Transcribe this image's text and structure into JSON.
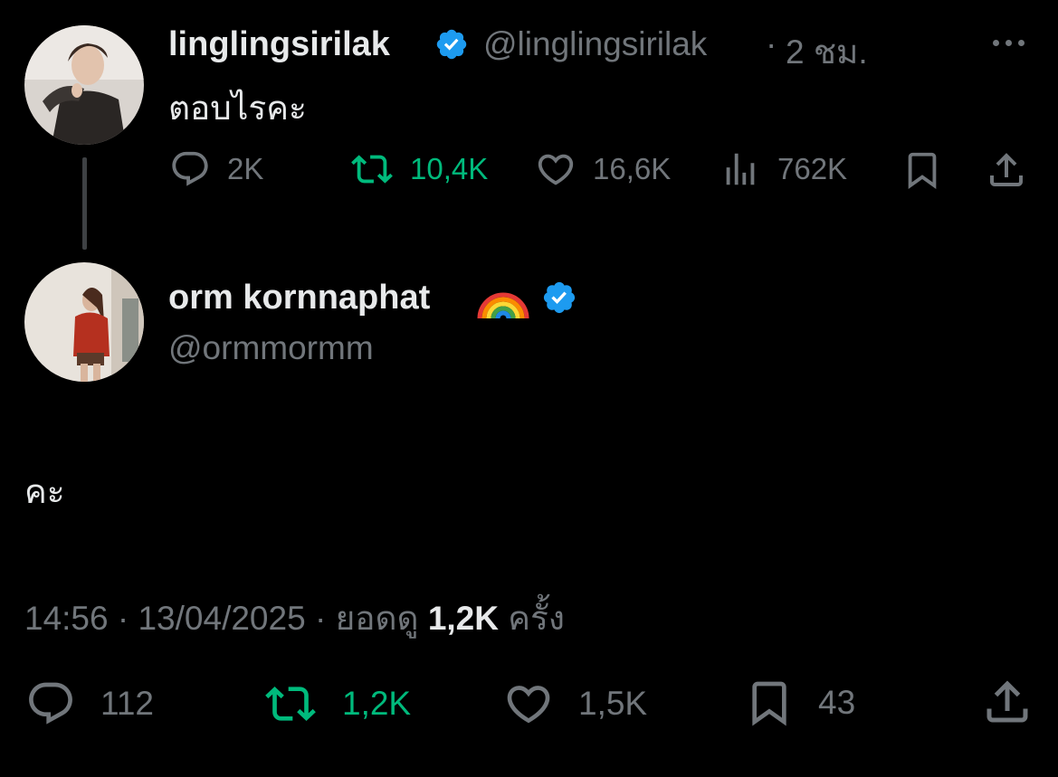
{
  "colors": {
    "background": "#000000",
    "primary_text": "#e7e9ea",
    "secondary_text": "#71767b",
    "retweet_green": "#00ba7c",
    "verified_blue": "#1d9bf0",
    "thread_line": "#3e4144"
  },
  "parent_tweet": {
    "display_name": "linglingsirilak",
    "handle": "@linglingsirilak",
    "separator": "·",
    "time_ago": "2 ชม.",
    "text": "ตอบไรคะ",
    "verified_icon": "verified-badge-icon",
    "more_icon": "more-horizontal-icon",
    "actions": {
      "reply": {
        "icon": "reply-icon",
        "count": "2K"
      },
      "repost": {
        "icon": "repost-icon",
        "count": "10,4K"
      },
      "like": {
        "icon": "heart-icon",
        "count": "16,6K"
      },
      "views": {
        "icon": "views-chart-icon",
        "count": "762K"
      },
      "bookmark": {
        "icon": "bookmark-icon"
      },
      "share": {
        "icon": "share-icon"
      }
    }
  },
  "reply_tweet": {
    "display_name": "orm kornnaphat",
    "name_emoji": "🌈",
    "handle": "@ormmormm",
    "verified_icon": "verified-badge-icon",
    "text": "คะ",
    "meta": {
      "time": "14:56",
      "date": "13/04/2025",
      "views_prefix": "ยอดดู",
      "views_count": "1,2K",
      "views_suffix": "ครั้ง"
    },
    "actions": {
      "reply": {
        "icon": "reply-icon",
        "count": "112"
      },
      "repost": {
        "icon": "repost-icon",
        "count": "1,2K"
      },
      "like": {
        "icon": "heart-icon",
        "count": "1,5K"
      },
      "bookmark": {
        "icon": "bookmark-icon",
        "count": "43"
      },
      "share": {
        "icon": "share-icon"
      }
    }
  }
}
